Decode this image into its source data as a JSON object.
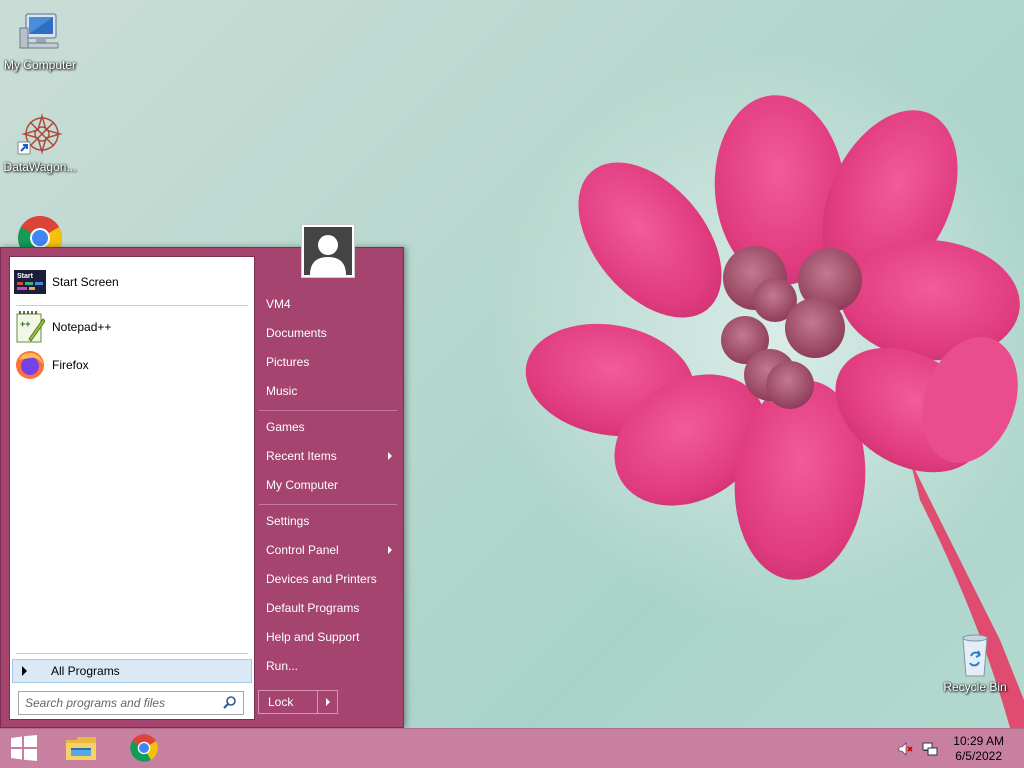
{
  "desktop": {
    "icons": [
      {
        "label": "My Computer",
        "icon": "computer-icon"
      },
      {
        "label": "DataWagon...",
        "icon": "datawagon-icon"
      },
      {
        "label": "",
        "icon": "chrome-icon"
      },
      {
        "label": "Recycle Bin",
        "icon": "recycle-bin-icon"
      }
    ]
  },
  "start_menu": {
    "pinned_programs": [
      {
        "label": "Start Screen",
        "icon": "start-screen-icon"
      },
      {
        "label": "Notepad++",
        "icon": "notepadpp-icon"
      },
      {
        "label": "Firefox",
        "icon": "firefox-icon"
      }
    ],
    "all_programs_label": "All Programs",
    "search_placeholder": "Search programs and files",
    "user_name": "VM4",
    "right_items": [
      {
        "label": "VM4"
      },
      {
        "label": "Documents"
      },
      {
        "label": "Pictures"
      },
      {
        "label": "Music"
      },
      {
        "label": "Games"
      },
      {
        "label": "Recent Items",
        "submenu": true
      },
      {
        "label": "My Computer"
      },
      {
        "label": "Settings"
      },
      {
        "label": "Control Panel",
        "submenu": true
      },
      {
        "label": "Devices and Printers"
      },
      {
        "label": "Default Programs"
      },
      {
        "label": "Help and Support"
      },
      {
        "label": "Run..."
      }
    ],
    "lock_label": "Lock"
  },
  "taskbar": {
    "start_icon": "windows-logo-icon",
    "pinned": [
      "file-explorer-icon",
      "chrome-icon"
    ],
    "tray": [
      "volume-muted-icon",
      "network-icon"
    ],
    "time": "10:29 AM",
    "date": "6/5/2022"
  },
  "colors": {
    "start_menu_bg": "#a4446f",
    "taskbar_bg": "#c7809f",
    "accent": "#dbe9f7"
  }
}
